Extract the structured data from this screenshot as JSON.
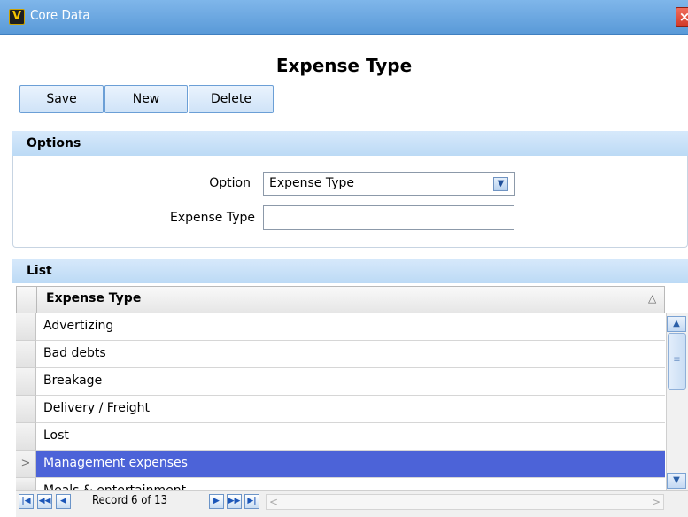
{
  "window": {
    "title": "Core Data",
    "logo": "V",
    "close": "×"
  },
  "page": {
    "heading": "Expense Type"
  },
  "toolbar": {
    "save": "Save",
    "new": "New",
    "delete": "Delete"
  },
  "options": {
    "title": "Options",
    "option_label": "Option",
    "option_value": "Expense Type",
    "expense_type_label": "Expense Type",
    "expense_type_value": ""
  },
  "list": {
    "title": "List",
    "column": "Expense Type",
    "sort_glyph": "△",
    "rows": [
      "Advertizing",
      "Bad debts",
      "Breakage",
      "Delivery / Freight",
      "Lost",
      "Management expenses",
      "Meals & entertainment"
    ],
    "selected_index": 5,
    "selector_glyph": ">"
  },
  "navigator": {
    "record_text": "Record 6 of 13"
  }
}
